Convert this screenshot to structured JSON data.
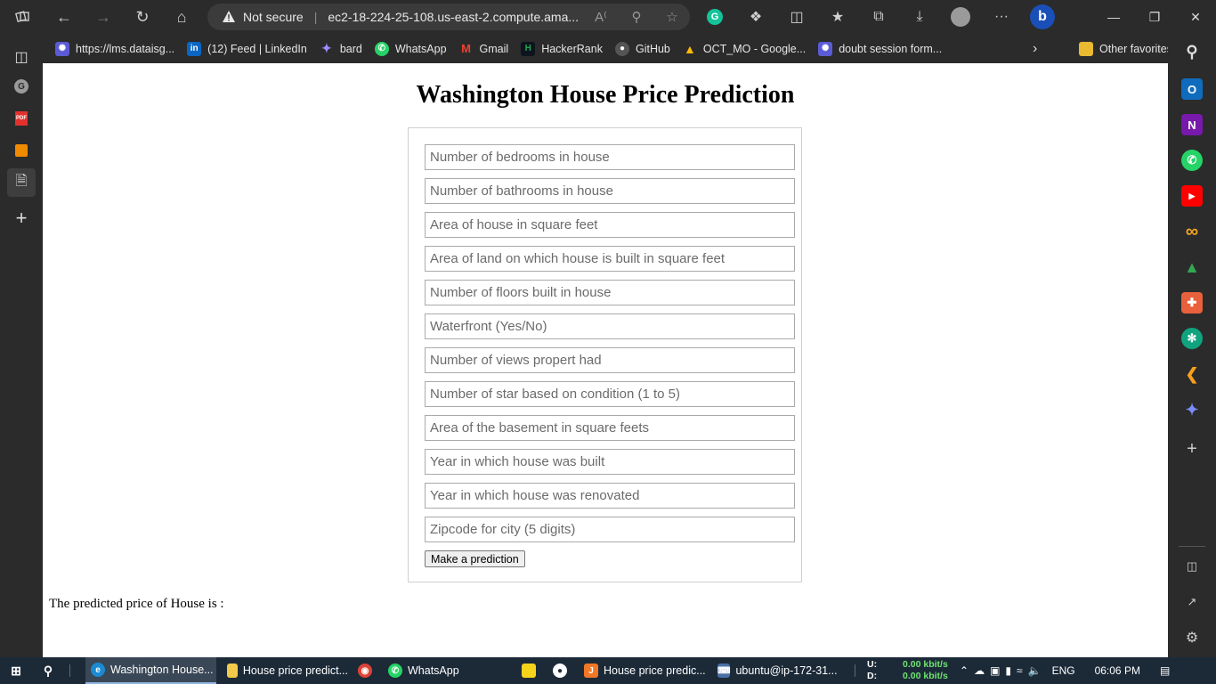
{
  "browser": {
    "security_label": "Not secure",
    "url": "ec2-18-224-25-108.us-east-2.compute.ama...",
    "favorites": [
      {
        "label": "https://lms.dataisg...",
        "icon": "web-icon",
        "color": "#5b5bd6"
      },
      {
        "label": "(12) Feed | LinkedIn",
        "icon": "linkedin-icon",
        "color": "#0a66c2"
      },
      {
        "label": "bard",
        "icon": "bard-icon",
        "color": "#7b61ff"
      },
      {
        "label": "WhatsApp",
        "icon": "whatsapp-icon",
        "color": "#25d366"
      },
      {
        "label": "Gmail",
        "icon": "gmail-icon",
        "color": "#ea4335"
      },
      {
        "label": "HackerRank",
        "icon": "hackerrank-icon",
        "color": "#1ba94c"
      },
      {
        "label": "GitHub",
        "icon": "github-icon",
        "color": "#555555"
      },
      {
        "label": "OCT_MO - Google...",
        "icon": "google-drive-icon",
        "color": "#fbbc04"
      },
      {
        "label": "doubt session form...",
        "icon": "web-icon",
        "color": "#5b5bd6"
      }
    ],
    "other_favorites": "Other favorites"
  },
  "page": {
    "title": "Washington House Price Prediction",
    "fields": [
      "Number of bedrooms in house",
      "Number of bathrooms in house",
      "Area of house in square feet",
      "Area of land on which house is built in square feet",
      "Number of floors built in house",
      "Waterfront (Yes/No)",
      "Number of views propert had",
      "Number of star based on condition (1 to 5)",
      "Area of the basement in square feets",
      "Year in which house was built",
      "Year in which house was renovated",
      "Zipcode for city (5 digits)"
    ],
    "button_label": "Make a prediction",
    "result_label": "The predicted price of House is :"
  },
  "taskbar": {
    "items": [
      {
        "label": "Washington House...",
        "icon": "edge-icon"
      },
      {
        "label": "House price predict...",
        "icon": "folder-icon"
      },
      {
        "label": "WhatsApp",
        "icon": "whatsapp-icon"
      },
      {
        "label": "House price predic...",
        "icon": "jupyter-icon"
      },
      {
        "label": "ubuntu@ip-172-31...",
        "icon": "putty-icon"
      }
    ],
    "net_up_label": "U:",
    "net_down_label": "D:",
    "net_up": "0.00 kbit/s",
    "net_down": "0.00 kbit/s",
    "language": "ENG",
    "time": "06:06 PM"
  }
}
